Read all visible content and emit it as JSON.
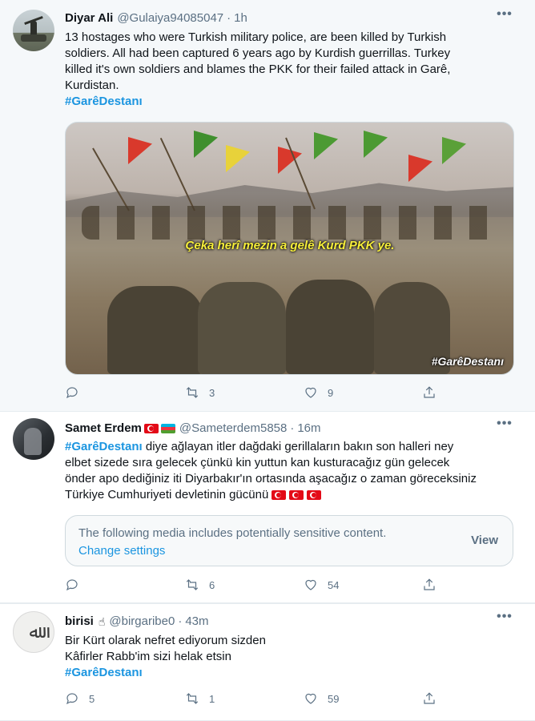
{
  "tweets": [
    {
      "name": "Diyar Ali",
      "handle": "@Gulaiya94085047",
      "time": "1h",
      "lines": [
        "13 hostages who were Turkish military police, are been killed by Turkish",
        "soldiers. All had been captured 6 years ago by Kurdish guerrillas. Turkey",
        "killed it's own soldiers and blames the PKK for their failed attack in Garê,",
        "Kurdistan."
      ],
      "hashtag": "#GarêDestanı",
      "media": {
        "caption": "Çeka herî mezin a gelê Kurd PKK ye.",
        "tag": "#GarêDestanı"
      },
      "replies": "",
      "retweets": "3",
      "likes": "9"
    },
    {
      "name": "Samet Erdem",
      "handle": "@Sameterdem5858",
      "time": "16m",
      "hashtag": "#GarêDestanı",
      "first_line_rest": " diye ağlayan itler dağdaki gerillaların bakın son halleri ney",
      "lines": [
        "elbet sizede sıra gelecek çünkü kin yuttun kan kusturacağız gün gelecek",
        "önder apo dediğiniz iti Diyarbakır'ın ortasında aşacağız o zaman göreceksiniz",
        "Türkiye Cumhuriyeti devletinin gücünü"
      ],
      "sensitive": {
        "message": "The following media includes potentially sensitive content.",
        "link": "Change settings",
        "button": "View"
      },
      "replies": "",
      "retweets": "6",
      "likes": "54"
    },
    {
      "name": "birisi",
      "handle": "@birgaribe0",
      "time": "43m",
      "lines": [
        "Bir Kürt olarak nefret ediyorum sizden",
        "Kâfirler Rabb'im sizi helak etsin"
      ],
      "hashtag": "#GarêDestanı",
      "replies": "5",
      "retweets": "1",
      "likes": "59"
    }
  ],
  "colors": {
    "link": "#1b95e0",
    "muted": "#5b7083",
    "highlight_bg": "#f5f8fa",
    "caption": "#f7ef3a"
  }
}
